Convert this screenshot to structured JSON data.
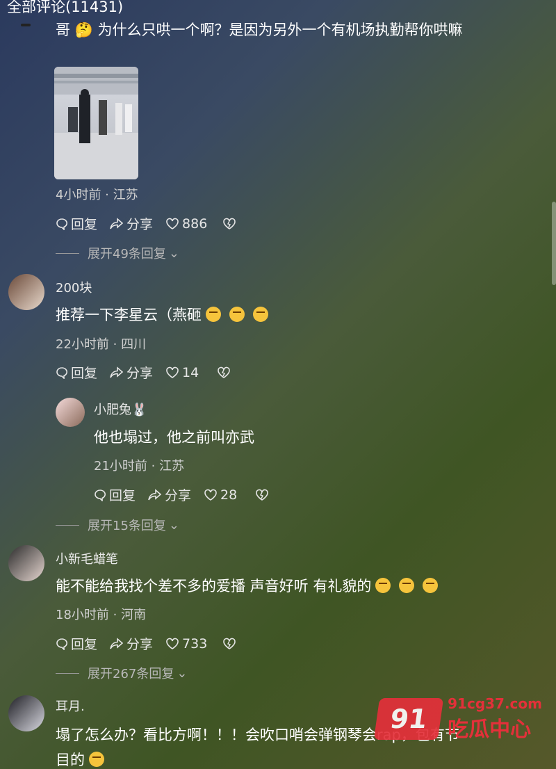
{
  "header": {
    "title": "全部评论(11431)"
  },
  "comments": [
    {
      "username": "",
      "text": "哥 🤔 为什么只哄一个啊？是因为另外一个有机场执勤帮你哄嘛",
      "time_location": "4小时前 · 江苏",
      "reply_label": "回复",
      "share_label": "分享",
      "likes": "886",
      "expand": "展开49条回复"
    },
    {
      "username": "200块",
      "text": "推荐一下李星云（燕砸",
      "time_location": "22小时前 · 四川",
      "reply_label": "回复",
      "share_label": "分享",
      "likes": "14",
      "reply": {
        "username": "小肥兔🐰",
        "text": "他也塌过，他之前叫亦武",
        "time_location": "21小时前 · 江苏",
        "reply_label": "回复",
        "share_label": "分享",
        "likes": "28"
      },
      "expand": "展开15条回复"
    },
    {
      "username": "小新毛蜡笔",
      "text": "能不能给我找个差不多的爱播 声音好听 有礼貌的",
      "time_location": "18小时前 · 河南",
      "reply_label": "回复",
      "share_label": "分享",
      "likes": "733",
      "expand": "展开267条回复"
    },
    {
      "username": "耳月.",
      "text_line1": "塌了怎么办？看比方啊！！！会吹口哨会弹钢琴会rap，包有节",
      "text_line2": "目的"
    }
  ],
  "watermark": {
    "badge": "91",
    "domain": "91cg37.com",
    "name": "吃瓜中心"
  },
  "colors": {
    "watermark_red": "#e4303a"
  }
}
